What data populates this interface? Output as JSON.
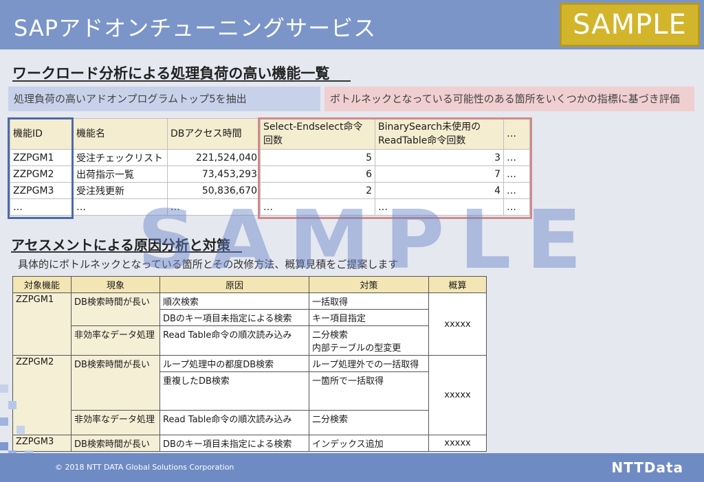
{
  "header": {
    "title": "SAPアドオンチューニングサービス",
    "badge": "SAMPLE"
  },
  "section1": {
    "heading": "ワークロード分析による処理負荷の高い機能一覧",
    "note_left": "処理負荷の高いアドオンプログラムトップ5を抽出",
    "note_right": "ボトルネックとなっている可能性のある箇所をいくつかの指標に基づき評価"
  },
  "table1": {
    "headers": [
      "機能ID",
      "機能名",
      "DBアクセス時間",
      "Select-Endselect命令",
      "回数",
      "BinarySearch未使用の",
      "ReadTable命令回数",
      "…"
    ],
    "rows": [
      [
        "ZZPGM1",
        "受注チェックリスト",
        "221,524,040",
        "5",
        "3",
        "…"
      ],
      [
        "ZZPGM2",
        "出荷指示一覧",
        "73,453,293",
        "6",
        "7",
        "…"
      ],
      [
        "ZZPGM3",
        "受注残更新",
        "50,836,670",
        "2",
        "4",
        "…"
      ],
      [
        "…",
        "…",
        "…",
        "…",
        "…",
        "…"
      ]
    ]
  },
  "section2": {
    "heading": "アセスメントによる原因分析と対策",
    "subtitle": "具体的にボトルネックとなっている箇所とその改修方法、概算見積をご提案します"
  },
  "table2": {
    "headers": [
      "対象機能",
      "現象",
      "原因",
      "対策",
      "概算"
    ],
    "g1": {
      "id": "ZZPGM1",
      "p1": "DB検索時間が長い",
      "c1": "順次検索",
      "m1": "一括取得",
      "c2": "DBのキー項目未指定による検索",
      "m2": "キー項目指定",
      "p2": "非効率なデータ処理",
      "c3": "Read Table命令の順次読み込み",
      "m3a": "二分検索",
      "m3b": "内部テーブルの型変更",
      "est": "xxxxx"
    },
    "g2": {
      "id": "ZZPGM2",
      "p1": "DB検索時間が長い",
      "c1": "ループ処理中の都度DB検索",
      "m1": "ループ処理外での一括取得",
      "c2": "重複したDB検索",
      "m2": "一箇所で一括取得",
      "p2": "非効率なデータ処理",
      "c3": "Read Table命令の順次読み込み",
      "m3": "二分検索",
      "est": "xxxxx"
    },
    "g3": {
      "id": "ZZPGM3",
      "p1": "DB検索時間が長い",
      "c1": "DBのキー項目未指定による検索",
      "m1": "インデックス追加",
      "est": "xxxxx"
    }
  },
  "watermark": "SAMPLE",
  "footer": {
    "copyright": "© 2018 NTT DATA Global Solutions Corporation",
    "logo": "NTTData"
  },
  "colors": {
    "header": "#7b95c9",
    "badge": "#d3b52c",
    "footer": "#6f8bc4",
    "blue_frame": "#4c6aa8",
    "red_frame": "#d08a8a"
  }
}
